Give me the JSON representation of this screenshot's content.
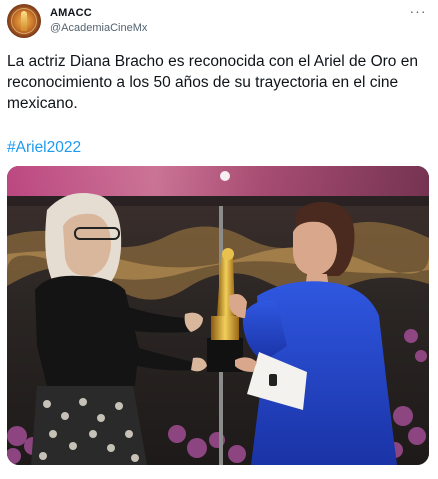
{
  "author": {
    "display_name": "AMACC",
    "handle": "@AcademiaCineMx",
    "avatar_icon": "amacc-logo-avatar"
  },
  "menu": {
    "more_label": "···",
    "more_icon": "more-options-icon"
  },
  "tweet": {
    "text": "La actriz Diana Bracho es reconocida con el Ariel de Oro en reconocimiento a los 50 años de su trayectoria en el cine mexicano.",
    "hashtag": "#Ariel2022"
  },
  "colors": {
    "text": "#0f1419",
    "muted": "#536471",
    "link": "#1d9bf0",
    "dress_blue": "#1f3fb8"
  }
}
